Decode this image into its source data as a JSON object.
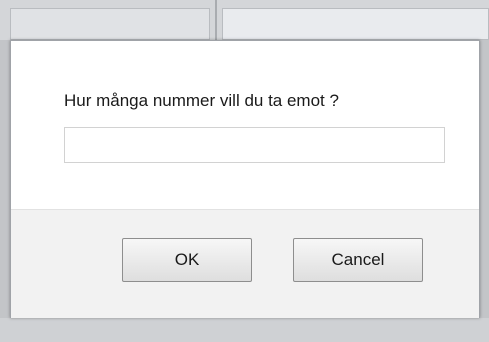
{
  "dialog": {
    "prompt": "Hur många nummer vill du ta emot ?",
    "input_value": "",
    "input_placeholder": "",
    "ok_label": "OK",
    "cancel_label": "Cancel"
  },
  "colors": {
    "dialog_background": "#ffffff",
    "footer_background": "#f2f2f2",
    "backdrop": "#c3c5c8"
  }
}
